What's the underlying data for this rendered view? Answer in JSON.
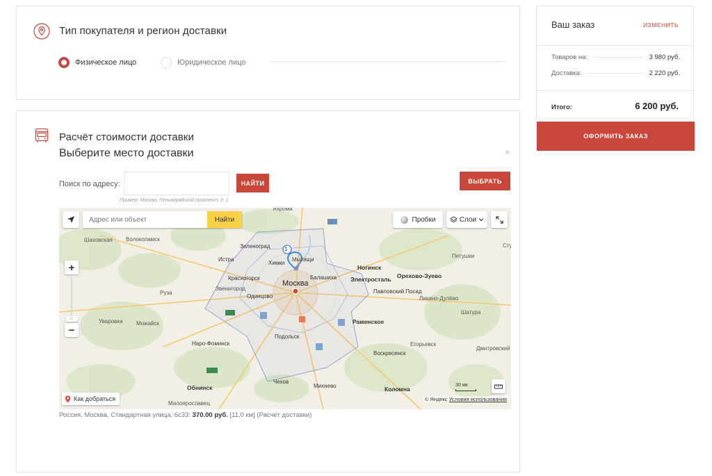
{
  "buyer_section": {
    "title": "Тип покупателя и регион доставки",
    "options": [
      "Физическое лицо",
      "Юридическое лицо"
    ],
    "selected": 0
  },
  "delivery_section": {
    "title": "Расчёт стоимости доставки",
    "subtitle": "Выберите место доставки",
    "close": "×",
    "search_label": "Поиск по адресу:",
    "search_value": "",
    "find_button": "найти",
    "choose_button": "выбрать",
    "hint": "Пример: Москва, Ленинградский проспект, д. 1",
    "result_address": "Россия, Москва, Стандартная улица, 6с33:",
    "result_price": "370.00 руб.",
    "result_rest": "[11,0 км] (Расчет доставки)"
  },
  "map": {
    "search_placeholder": "Адрес или объект",
    "search_button": "Найти",
    "traffic_button": "Пробки",
    "layers_button": "Слои",
    "route_button": "Как добраться",
    "copyright": "© Яндекс",
    "terms": "Условия использования",
    "scale": "30 км",
    "marker_label": "1",
    "labels": [
      {
        "text": "Шаховская",
        "cls": "muted"
      },
      {
        "text": "Волоколамск",
        "cls": "muted"
      },
      {
        "text": "Истра",
        "cls": ""
      },
      {
        "text": "Зеленоград",
        "cls": ""
      },
      {
        "text": "Химки",
        "cls": ""
      },
      {
        "text": "Мытищи",
        "cls": ""
      },
      {
        "text": "Ногинск",
        "cls": "bold"
      },
      {
        "text": "Электросталь",
        "cls": "bold"
      },
      {
        "text": "Орехово-Зуево",
        "cls": "bold"
      },
      {
        "text": "Петушки",
        "cls": "muted"
      },
      {
        "text": "Красногорск",
        "cls": ""
      },
      {
        "text": "Балашиха",
        "cls": ""
      },
      {
        "text": "Москва",
        "cls": "big"
      },
      {
        "text": "Звенигород",
        "cls": "muted"
      },
      {
        "text": "Руза",
        "cls": "muted"
      },
      {
        "text": "Одинцово",
        "cls": ""
      },
      {
        "text": "Павловский Посад",
        "cls": ""
      },
      {
        "text": "Ликино-Дулёво",
        "cls": "muted"
      },
      {
        "text": "Шатура",
        "cls": "muted"
      },
      {
        "text": "Уваровка",
        "cls": "muted"
      },
      {
        "text": "Можайск",
        "cls": "muted"
      },
      {
        "text": "Раменское",
        "cls": "bold"
      },
      {
        "text": "Наро-Фоминск",
        "cls": ""
      },
      {
        "text": "Подольск",
        "cls": ""
      },
      {
        "text": "Егорьевск",
        "cls": "muted"
      },
      {
        "text": "Дмитровский Погост",
        "cls": "muted"
      },
      {
        "text": "Воскресенск",
        "cls": ""
      },
      {
        "text": "Обнинск",
        "cls": "bold"
      },
      {
        "text": "Чехов",
        "cls": ""
      },
      {
        "text": "Михнево",
        "cls": ""
      },
      {
        "text": "Коломна",
        "cls": "bold"
      },
      {
        "text": "Малоярославец",
        "cls": "muted"
      },
      {
        "text": "Яхрома",
        "cls": "muted"
      },
      {
        "text": "Ступино",
        "cls": "muted"
      }
    ]
  },
  "order": {
    "title": "Ваш заказ",
    "edit": "изменить",
    "goods_label": "Товаров на:",
    "goods_value": "3 980 руб.",
    "delivery_label": "Доставка:",
    "delivery_value": "2 220 руб.",
    "total_label": "Итого:",
    "total_value": "6 200 руб.",
    "checkout_button": "оформить заказ"
  },
  "colors": {
    "accent": "#c8473a",
    "map_search_button": "#f8d245"
  }
}
